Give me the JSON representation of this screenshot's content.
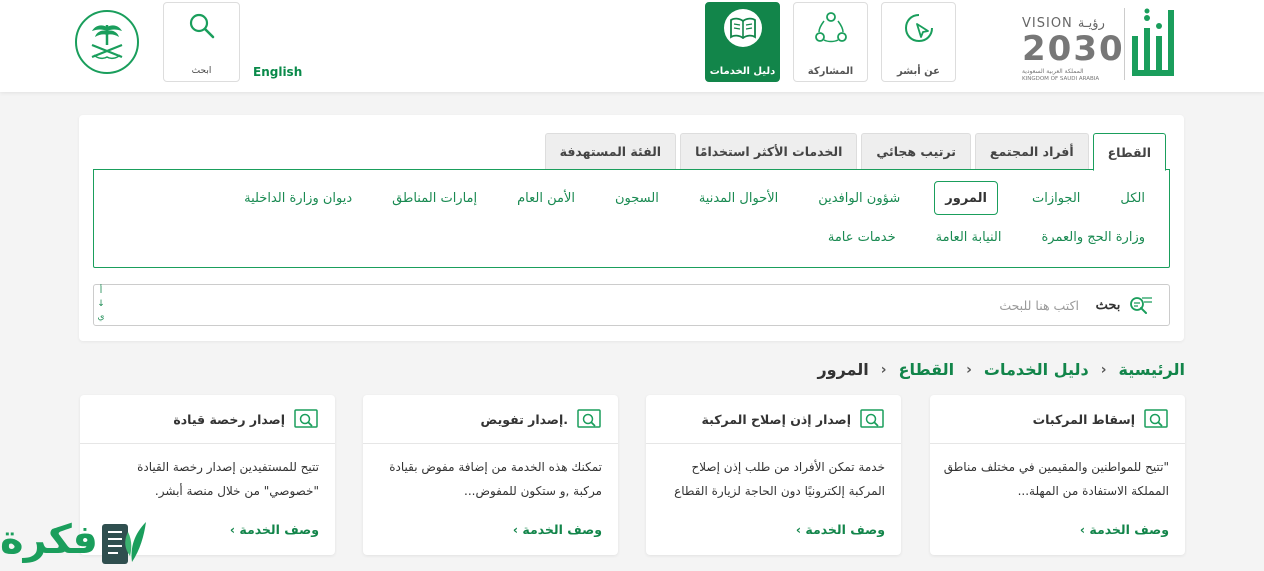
{
  "header": {
    "lang_label": "English",
    "search_label": "ابحث",
    "nav": [
      {
        "label": "دليل الخدمات",
        "icon": "open-book-icon",
        "active": true
      },
      {
        "label": "المشاركة",
        "icon": "share-network-icon",
        "active": false
      },
      {
        "label": "عن أبشر",
        "icon": "chat-pointer-icon",
        "active": false
      }
    ],
    "vision": {
      "title": "VISION رؤيـة",
      "year": "2030",
      "ar_country": "المملكة العربية السعودية",
      "en_country": "KINGDOM OF SAUDI ARABIA"
    },
    "accent_color": "#12854a"
  },
  "tabs": [
    "القطاع",
    "أفراد المجتمع",
    "ترتيب هجائي",
    "الخدمات الأكثر استخدامًا",
    "الفئة المستهدفة"
  ],
  "active_tab": "القطاع",
  "categories": [
    {
      "label": "الكل",
      "active": false
    },
    {
      "label": "الجوازات",
      "active": false
    },
    {
      "label": "المرور",
      "active": true
    },
    {
      "label": "شؤون الوافدين",
      "active": false
    },
    {
      "label": "الأحوال المدنية",
      "active": false
    },
    {
      "label": "السجون",
      "active": false
    },
    {
      "label": "الأمن العام",
      "active": false
    },
    {
      "label": "إمارات المناطق",
      "active": false
    },
    {
      "label": "ديوان وزارة الداخلية",
      "active": false
    },
    {
      "label": "وزارة الحج والعمرة",
      "active": false
    },
    {
      "label": "النيابة العامة",
      "active": false
    },
    {
      "label": "خدمات عامة",
      "active": false
    }
  ],
  "search": {
    "placeholder": "اكتب هنا للبحث",
    "button_label": "بحث",
    "scroll_hint": [
      "أ",
      "↓",
      "ي"
    ]
  },
  "breadcrumb": {
    "home": "الرئيسية",
    "guide": "دليل الخدمات",
    "sector": "القطاع",
    "current": "المرور",
    "separator": "›"
  },
  "cards": [
    {
      "title": "إسقاط المركبات",
      "desc": "\"تتيح للمواطنين والمقيمين في مختلف مناطق المملكة الاستفادة من المهلة...",
      "link": "وصف الخدمة ›"
    },
    {
      "title": "إصدار إذن إصلاح المركبة",
      "desc": "خدمة تمكن الأفراد من طلب إذن إصلاح المركبة إلكترونيًا دون الحاجة لزيارة القطاع",
      "link": "وصف الخدمة ›"
    },
    {
      "title": "إصدار تفويض.",
      "desc": "تمكنك هذه الخدمة من إضافة مفوض بقيادة مركبة ,و ستكون للمفوض...",
      "link": "وصف الخدمة ›"
    },
    {
      "title": "إصدار رخصة قيادة",
      "desc": "تتيح للمستفيدين إصدار رخصة القيادة \"خصوصي\" من خلال منصة أبشر.",
      "link": "وصف الخدمة ›"
    }
  ],
  "watermark": {
    "text": "فكرة"
  }
}
